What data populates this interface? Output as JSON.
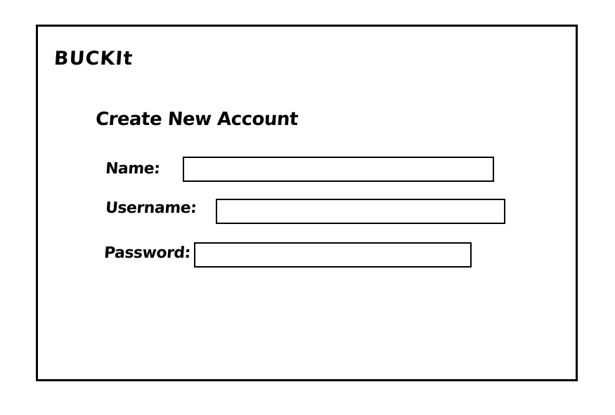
{
  "app": {
    "title": "BUCKIt"
  },
  "form": {
    "title": "Create New Account",
    "fields": {
      "name": {
        "label": "Name:",
        "value": "",
        "placeholder": ""
      },
      "username": {
        "label": "Username:",
        "value": "",
        "placeholder": ""
      },
      "password": {
        "label": "Password:",
        "value": "",
        "placeholder": ""
      }
    }
  }
}
